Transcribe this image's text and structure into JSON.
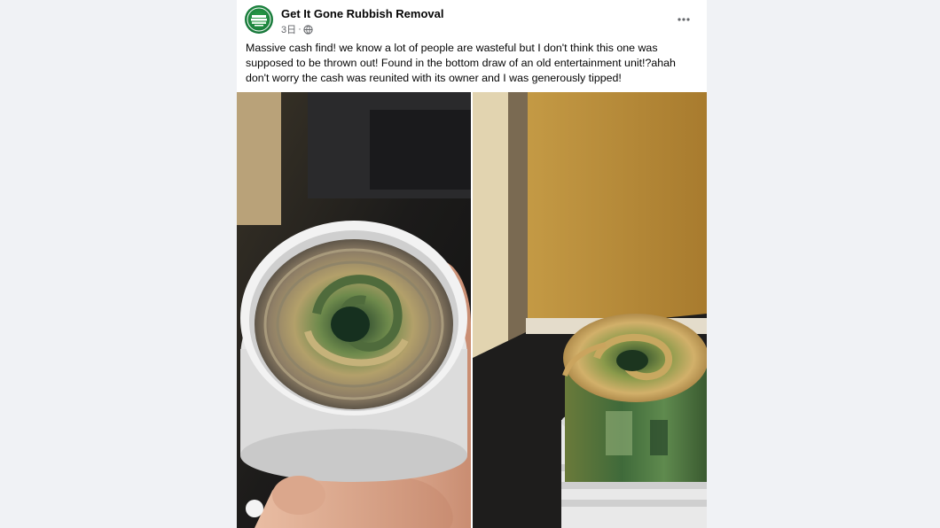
{
  "post": {
    "page_name": "Get It Gone Rubbish Removal",
    "timestamp": "3日",
    "separator": "·",
    "audience_icon": "globe-icon",
    "more_icon": "more-horizontal-icon",
    "caption": "Massive cash find! we know a lot of people are wasteful but I don't think this one was supposed to be thrown out! Found in the bottom draw of an old entertainment unit!?ahah don't worry the cash was reunited with its owner and I was generously tipped!",
    "photos": [
      {
        "name": "photo-cash-roll-top-view",
        "subject": "rolled banknotes inside white container held in hand"
      },
      {
        "name": "photo-cash-roll-side-view",
        "subject": "rolled banknotes in white container on floor"
      }
    ]
  },
  "colors": {
    "page_background": "#f0f2f5",
    "card_background": "#ffffff",
    "text_primary": "#050505",
    "text_secondary": "#65676b",
    "avatar_green": "#17783a"
  }
}
